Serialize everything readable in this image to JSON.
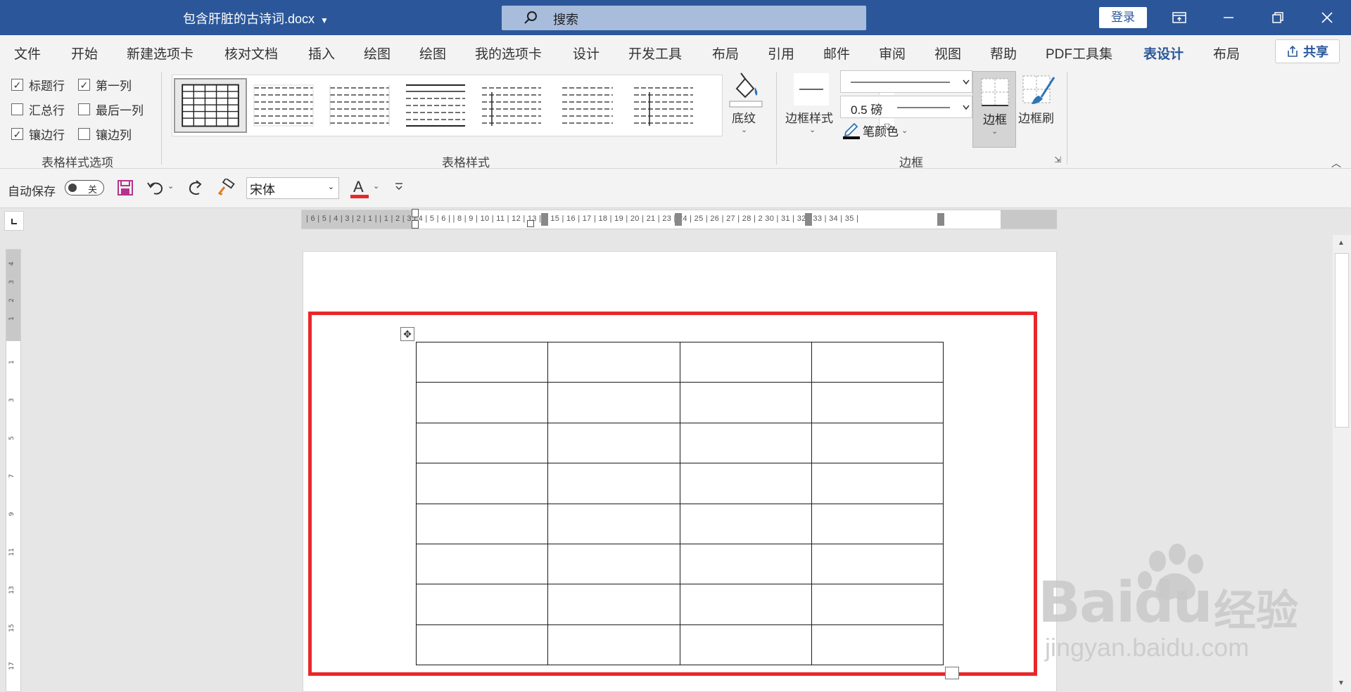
{
  "titlebar": {
    "doc_title": "包含肝脏的古诗词.docx",
    "search_label": "搜索",
    "login": "登录"
  },
  "tabs": [
    "文件",
    "开始",
    "新建选项卡",
    "核对文档",
    "插入",
    "绘图",
    "绘图",
    "我的选项卡",
    "设计",
    "开发工具",
    "布局",
    "引用",
    "邮件",
    "审阅",
    "视图",
    "帮助",
    "PDF工具集",
    "表设计",
    "布局"
  ],
  "active_tab": "表设计",
  "share": "共享",
  "ribbon": {
    "options": {
      "header_row": "标题行",
      "first_column": "第一列",
      "total_row": "汇总行",
      "last_column": "最后一列",
      "banded_rows": "镶边行",
      "banded_columns": "镶边列",
      "group_label": "表格样式选项"
    },
    "styles_group_label": "表格样式",
    "shading": "底纹",
    "border_styles": "边框样式",
    "pen_weight": "0.5 磅",
    "pen_color": "笔颜色",
    "borders": "边框",
    "border_painter": "边框刷",
    "borders_group_label": "边框"
  },
  "qat": {
    "autosave": "自动保存",
    "autosave_state": "关",
    "font": "宋体"
  },
  "ruler": {
    "h_numbers": "| 6 | 5 | 4 | 3 | 2 | 1 |     | 1 | 2 | 3 | 4 | 5 | 6 |     | 8 | 9 | 10 | 11 | 12 | 13 | 1     15 | 16 | 17 | 18 | 19 | 20 | 21     | 23 | 24 | 25 | 26 | 27 | 28 | 2     30 | 31 | 32 | 33 | 34 | 35 |"
  },
  "table": {
    "rows": 8,
    "cols": 4
  },
  "watermark": {
    "brand": "Baidu",
    "cn": "经验",
    "url": "jingyan.baidu.com"
  }
}
